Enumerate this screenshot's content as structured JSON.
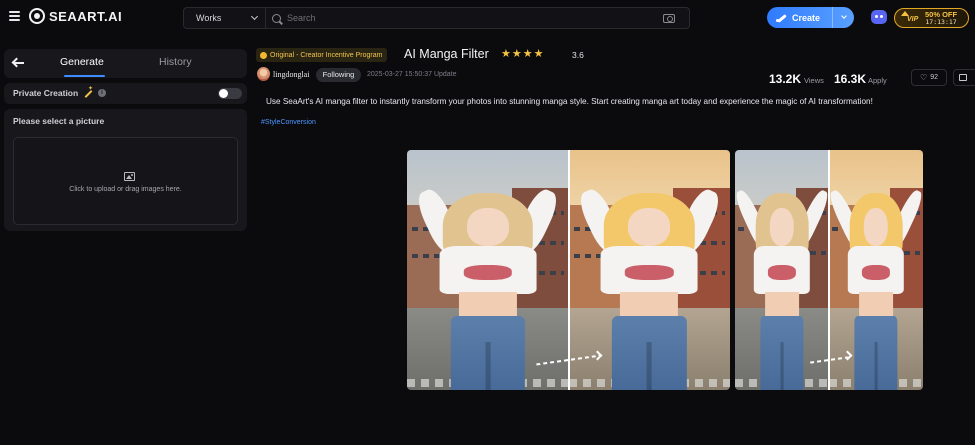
{
  "app": {
    "logo_text": "SEAART.AI"
  },
  "header": {
    "works_select": "Works",
    "search_placeholder": "Search",
    "create_label": "Create",
    "vip": {
      "label": "VIP",
      "discount": "50% OFF",
      "timer": "17:13:17"
    }
  },
  "sidebar": {
    "tabs": [
      {
        "label": "Generate",
        "active": true
      },
      {
        "label": "History",
        "active": false
      }
    ],
    "private_creation": {
      "label": "Private Creation",
      "enabled": false
    },
    "upload": {
      "title": "Please select a picture",
      "hint": "Click to upload or drag images here."
    }
  },
  "main": {
    "badge": "Original - Creator Incentive Program",
    "title": "AI Manga Filter",
    "stars": 4,
    "rating": "3.6",
    "author": "lingdonglai",
    "follow_label": "Following",
    "updated": "2025-03-27 15:50:37 Update",
    "views_count": "13.2K",
    "views_label": "Views",
    "apply_count": "16.3K",
    "apply_label": "Apply",
    "likes": "92",
    "description": "Use SeaArt's AI manga filter to instantly transform your photos into stunning manga style. Start creating manga art today and experience the magic of AI transformation!",
    "tag": "#StyleConversion"
  },
  "colors": {
    "accent": "#3d8bff",
    "star": "#f5c244",
    "vip_gold": "#e3a826",
    "background": "#0b0b0e",
    "panel": "#17171c"
  },
  "icons": {
    "menu": "hamburger-icon",
    "search": "search-icon",
    "camera": "camera-icon",
    "create": "brush-icon",
    "discord": "discord-icon",
    "back": "arrow-left-icon",
    "upload": "image-icon",
    "like": "heart-icon",
    "comment": "comment-icon"
  }
}
